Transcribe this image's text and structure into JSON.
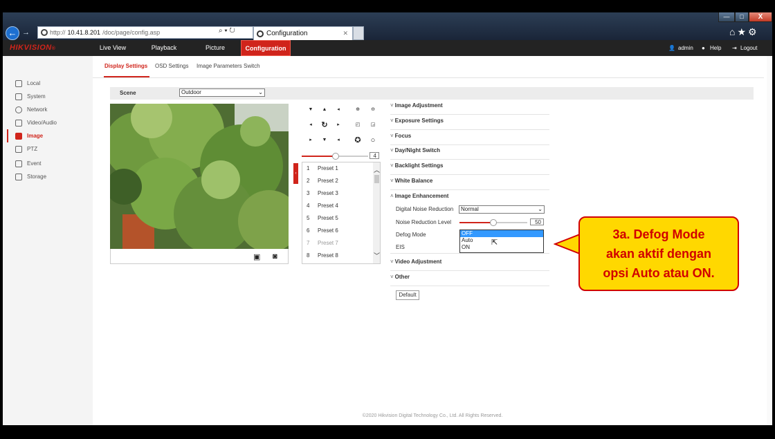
{
  "browser": {
    "url_prefix": "http://",
    "url_host": "10.41.8.201",
    "url_path": "/doc/page/config.asp",
    "tab_title": "Configuration",
    "window_close_label": "X"
  },
  "header": {
    "logo": "HIKVISION",
    "logo_mark": "®",
    "nav": [
      "Live View",
      "Playback",
      "Picture",
      "Configuration"
    ],
    "active_nav": "Configuration",
    "user": "admin",
    "help": "Help",
    "logout": "Logout"
  },
  "sidebar": {
    "items": [
      {
        "label": "Local",
        "icon": "monitor-icon"
      },
      {
        "label": "System",
        "icon": "system-icon"
      },
      {
        "label": "Network",
        "icon": "globe-icon"
      },
      {
        "label": "Video/Audio",
        "icon": "video-audio-icon"
      },
      {
        "label": "Image",
        "icon": "image-icon"
      },
      {
        "label": "PTZ",
        "icon": "ptz-icon"
      },
      {
        "label": "Event",
        "icon": "event-icon"
      },
      {
        "label": "Storage",
        "icon": "storage-icon"
      }
    ],
    "active": "Image"
  },
  "subtabs": [
    "Display Settings",
    "OSD Settings",
    "Image Parameters Switch"
  ],
  "scene": {
    "label": "Scene",
    "value": "Outdoor"
  },
  "ptz": {
    "speed_value": "4"
  },
  "presets": [
    {
      "num": "1",
      "label": "Preset 1"
    },
    {
      "num": "2",
      "label": "Preset 2"
    },
    {
      "num": "3",
      "label": "Preset 3"
    },
    {
      "num": "4",
      "label": "Preset 4"
    },
    {
      "num": "5",
      "label": "Preset 5"
    },
    {
      "num": "6",
      "label": "Preset 6"
    },
    {
      "num": "7",
      "label": "Preset 7"
    },
    {
      "num": "8",
      "label": "Preset 8"
    }
  ],
  "sections": [
    {
      "label": "Image Adjustment",
      "chev": "˅"
    },
    {
      "label": "Exposure Settings",
      "chev": "˅"
    },
    {
      "label": "Focus",
      "chev": "˅"
    },
    {
      "label": "Day/Night Switch",
      "chev": "˅"
    },
    {
      "label": "Backlight Settings",
      "chev": "˅"
    },
    {
      "label": "White Balance",
      "chev": "˅"
    },
    {
      "label": "Image Enhancement",
      "chev": "˄"
    }
  ],
  "enhancement": {
    "dnr_label": "Digital Noise Reduction",
    "dnr_value": "Normal",
    "nrl_label": "Noise Reduction Level",
    "nrl_value": "50",
    "nrl_fraction": 0.5,
    "defog_label": "Defog Mode",
    "defog_options": [
      "OFF",
      "Auto",
      "ON"
    ],
    "defog_selected": "OFF",
    "eis_label": "EIS"
  },
  "sections_after": [
    {
      "label": "Video Adjustment",
      "chev": "˅"
    },
    {
      "label": "Other",
      "chev": "˅"
    }
  ],
  "default_button": "Default",
  "footer": "©2020 Hikvision Digital Technology Co., Ltd. All Rights Reserved.",
  "callout": {
    "line1": "3a. Defog Mode",
    "line2": "akan aktif dengan",
    "line3": "opsi Auto atau ON."
  },
  "colors": {
    "accent": "#d0241b",
    "callout_bg": "#ffd800",
    "callout_text": "#d10000",
    "selection": "#3399ff"
  }
}
